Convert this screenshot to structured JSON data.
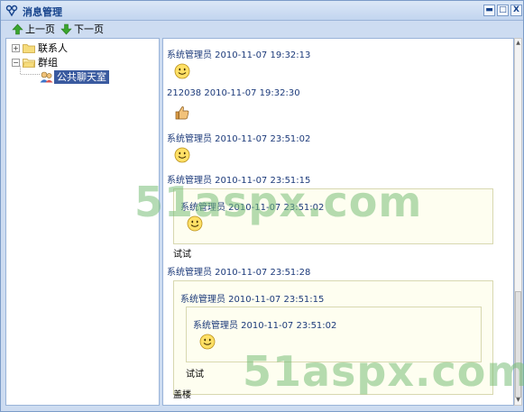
{
  "window": {
    "title": "消息管理",
    "min": "▬",
    "max": "□",
    "close": "X"
  },
  "toolbar": {
    "prev": "上一页",
    "next": "下一页"
  },
  "tree": {
    "contacts": "联系人",
    "groups": "群组",
    "public_room": "公共聊天室",
    "collapsed_sign": "+",
    "expanded_sign": "−"
  },
  "messages": {
    "m1": {
      "meta": "系统管理员  2010-11-07 19:32:13",
      "icon": "smile-icon"
    },
    "m2": {
      "meta": "212038  2010-11-07 19:32:30",
      "icon": "thumbs-up-icon"
    },
    "m3": {
      "meta": "系统管理员  2010-11-07 23:51:02",
      "icon": "smile-icon"
    },
    "m4": {
      "meta": "系统管理员  2010-11-07 23:51:15",
      "quote": {
        "meta": "系统管理员  2010-11-07 23:51:02",
        "icon": "smile-icon"
      },
      "text": "试试"
    },
    "m5": {
      "meta": "系统管理员  2010-11-07 23:51:28",
      "quote": {
        "meta": "系统管理员  2010-11-07 23:51:15",
        "inner": {
          "meta": "系统管理员  2010-11-07 23:51:02",
          "icon": "smile-icon"
        },
        "text": "试试"
      },
      "text": "盖楼"
    }
  },
  "watermark": {
    "text": "51aspx.com"
  },
  "colors": {
    "title_bg": "#c2d5ef",
    "border": "#99b3d8",
    "meta_text": "#1c3a7a",
    "quote_bg": "#fefef0",
    "selected_bg": "#3a5a9f",
    "watermark": "#78be78"
  }
}
